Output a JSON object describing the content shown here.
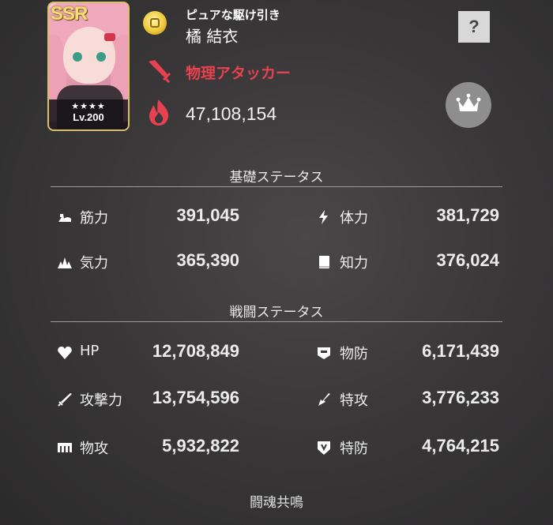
{
  "character": {
    "rarity": "SSR",
    "stars": "★★★★",
    "level": "Lv.200",
    "title": "ピュアな駆け引き",
    "name": "橘 結衣",
    "role": "物理アタッカー",
    "combat_power": "47,108,154",
    "role_color": "#e8414f"
  },
  "buttons": {
    "help_label": "?",
    "crown_icon": "crown-icon"
  },
  "basic_status": {
    "title": "基礎ステータス",
    "items": [
      {
        "icon": "strength-icon",
        "label": "筋力",
        "value": "391,045"
      },
      {
        "icon": "stamina-icon",
        "label": "体力",
        "value": "381,729"
      },
      {
        "icon": "spirit-icon",
        "label": "気力",
        "value": "365,390"
      },
      {
        "icon": "intellect-icon",
        "label": "知力",
        "value": "376,024"
      }
    ]
  },
  "battle_status": {
    "title": "戦闘ステータス",
    "items": [
      {
        "icon": "heart-icon",
        "label": "HP",
        "value": "12,708,849"
      },
      {
        "icon": "physical-defense-icon",
        "label": "物防",
        "value": "6,171,439"
      },
      {
        "icon": "sword-icon",
        "label": "攻撃力",
        "value": "13,754,596"
      },
      {
        "icon": "special-attack-icon",
        "label": "特攻",
        "value": "3,776,233"
      },
      {
        "icon": "physical-attack-icon",
        "label": "物攻",
        "value": "5,932,822"
      },
      {
        "icon": "special-defense-icon",
        "label": "特防",
        "value": "4,764,215"
      }
    ]
  },
  "footer": {
    "label": "闘魂共鳴"
  }
}
